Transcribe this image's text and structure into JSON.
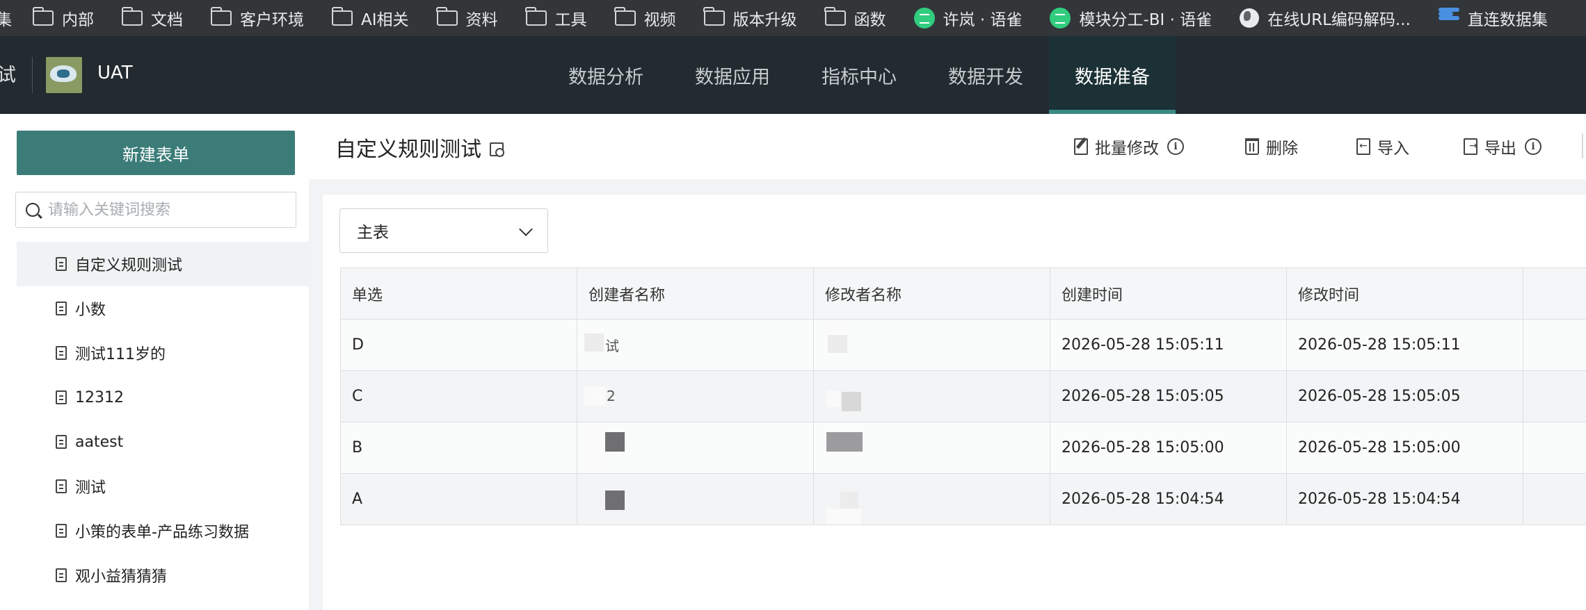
{
  "bookmarks": [
    {
      "label": "集",
      "icon": "none"
    },
    {
      "label": "内部",
      "icon": "folder-icon"
    },
    {
      "label": "文档",
      "icon": "folder-icon"
    },
    {
      "label": "客户环境",
      "icon": "folder-icon"
    },
    {
      "label": "AI相关",
      "icon": "folder-icon"
    },
    {
      "label": "资料",
      "icon": "folder-icon"
    },
    {
      "label": "工具",
      "icon": "folder-icon"
    },
    {
      "label": "视频",
      "icon": "folder-icon"
    },
    {
      "label": "版本升级",
      "icon": "folder-icon"
    },
    {
      "label": "函数",
      "icon": "folder-icon"
    },
    {
      "label": "许岚 · 语雀",
      "icon": "yuque-icon"
    },
    {
      "label": "模块分工-BI · 语雀",
      "icon": "yuque-icon"
    },
    {
      "label": "在线URL编码解码...",
      "icon": "globe-icon"
    },
    {
      "label": "直连数据集",
      "icon": "stack-icon"
    }
  ],
  "header": {
    "left_cut_text": "试",
    "env_label": "UAT",
    "nav": [
      {
        "label": "数据分析",
        "active": false
      },
      {
        "label": "数据应用",
        "active": false
      },
      {
        "label": "指标中心",
        "active": false
      },
      {
        "label": "数据开发",
        "active": false
      },
      {
        "label": "数据准备",
        "active": true
      }
    ]
  },
  "sidebar": {
    "new_button_label": "新建表单",
    "search_placeholder": "请输入关键词搜索",
    "items": [
      {
        "label": "自定义规则测试",
        "selected": true
      },
      {
        "label": "小数",
        "selected": false
      },
      {
        "label": "测试111岁的",
        "selected": false
      },
      {
        "label": "12312",
        "selected": false
      },
      {
        "label": "aatest",
        "selected": false
      },
      {
        "label": "测试",
        "selected": false
      },
      {
        "label": "小策的表单-产品练习数据",
        "selected": false
      },
      {
        "label": "观小益猜猜猜",
        "selected": false
      }
    ]
  },
  "main": {
    "title": "自定义规则测试",
    "actions": {
      "batch_edit": "批量修改",
      "delete": "删除",
      "import": "导入",
      "export": "导出"
    },
    "table_select_value": "主表",
    "table": {
      "columns": [
        "单选",
        "创建者名称",
        "修改者名称",
        "创建时间",
        "修改时间"
      ],
      "rows": [
        {
          "choice": "D",
          "creator_partial": "试",
          "modifier_partial": "",
          "created": "2026-05-28 15:05:11",
          "modified": "2026-05-28 15:05:11"
        },
        {
          "choice": "C",
          "creator_partial": "2",
          "modifier_partial": "",
          "created": "2026-05-28 15:05:05",
          "modified": "2026-05-28 15:05:05"
        },
        {
          "choice": "B",
          "creator_partial": "",
          "modifier_partial": "",
          "created": "2026-05-28 15:05:00",
          "modified": "2026-05-28 15:05:00"
        },
        {
          "choice": "A",
          "creator_partial": "",
          "modifier_partial": "",
          "created": "2026-05-28 15:04:54",
          "modified": "2026-05-28 15:04:54"
        }
      ]
    }
  },
  "colors": {
    "bookmark_bar": "#323639",
    "header_bg": "#232b30",
    "nav_active_bg": "#1b3136",
    "accent": "#3b7c78"
  }
}
